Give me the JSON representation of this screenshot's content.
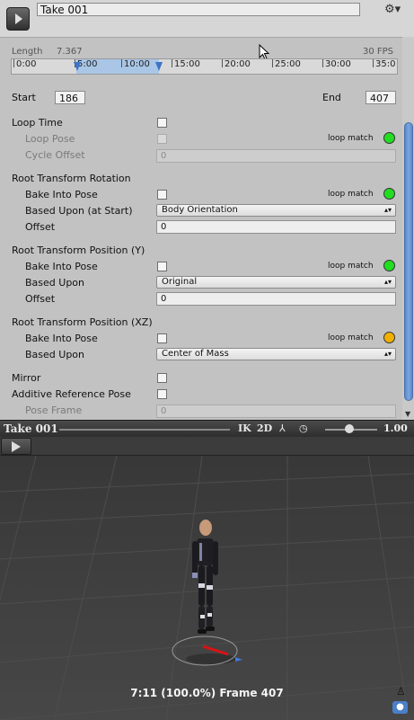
{
  "header": {
    "clip_name": "Take 001",
    "settings_icon": "gear-icon"
  },
  "timeline": {
    "length_label": "Length",
    "length_value": "7.367",
    "fps": "30 FPS",
    "ticks": [
      "0:00",
      "5:00",
      "10:00",
      "15:00",
      "20:00",
      "25:00",
      "30:00",
      "35:0"
    ]
  },
  "range": {
    "start_label": "Start",
    "start_value": "186",
    "end_label": "End",
    "end_value": "407"
  },
  "loop": {
    "loop_time": "Loop Time",
    "loop_pose": "Loop Pose",
    "loop_match": "loop match",
    "cycle_offset": "Cycle Offset",
    "cycle_offset_value": "0",
    "status_color": "#22dd22"
  },
  "root_rotation": {
    "title": "Root Transform Rotation",
    "bake": "Bake Into Pose",
    "loop_match": "loop match",
    "status_color": "#22dd22",
    "based_upon": "Based Upon (at Start)",
    "based_upon_value": "Body Orientation",
    "offset": "Offset",
    "offset_value": "0"
  },
  "root_position_y": {
    "title": "Root Transform Position (Y)",
    "bake": "Bake Into Pose",
    "loop_match": "loop match",
    "status_color": "#22dd22",
    "based_upon": "Based Upon",
    "based_upon_value": "Original",
    "offset": "Offset",
    "offset_value": "0"
  },
  "root_position_xz": {
    "title": "Root Transform Position (XZ)",
    "bake": "Bake Into Pose",
    "loop_match": "loop match",
    "status_color": "#f0b000",
    "based_upon": "Based Upon",
    "based_upon_value": "Center of Mass"
  },
  "misc": {
    "mirror": "Mirror",
    "additive": "Additive Reference Pose",
    "pose_frame": "Pose Frame",
    "pose_frame_value": "0"
  },
  "preview": {
    "title": "Take 001",
    "ik": "IK",
    "two_d": "2D",
    "speed": "1.00",
    "status": "7:11 (100.0%) Frame 407"
  }
}
